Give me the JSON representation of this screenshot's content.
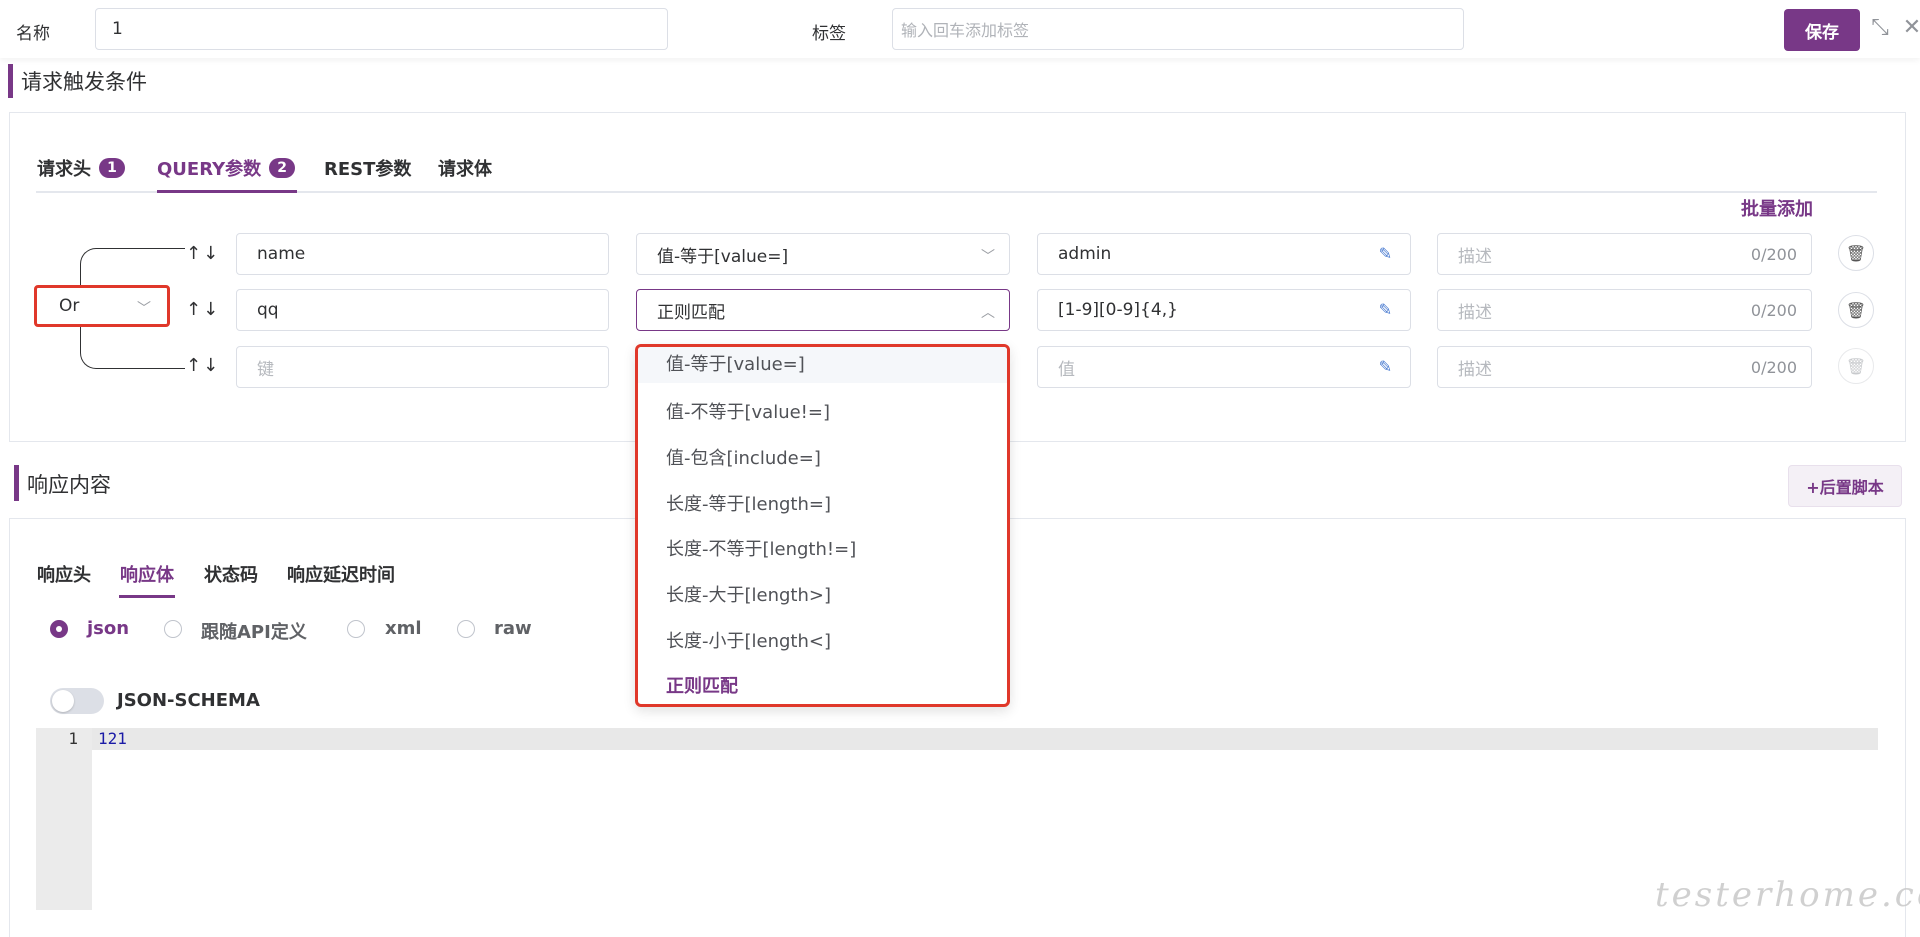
{
  "header": {
    "name_label": "名称",
    "name_value": "1",
    "tag_label": "标签",
    "tag_placeholder": "输入回车添加标签",
    "save_label": "保存"
  },
  "request_section": {
    "title": "请求触发条件",
    "tabs": [
      {
        "label": "请求头",
        "badge": "1"
      },
      {
        "label": "QUERY参数",
        "badge": "2",
        "active": true
      },
      {
        "label": "REST参数"
      },
      {
        "label": "请求体"
      }
    ],
    "batch_add": "批量添加",
    "logic_select": "Or",
    "rows": [
      {
        "key": "name",
        "condition": "值-等于[value=]",
        "value": "admin",
        "desc_placeholder": "描述",
        "desc_count": "0/200"
      },
      {
        "key": "qq",
        "condition": "正则匹配",
        "value": "[1-9][0-9]{4,}",
        "desc_placeholder": "描述",
        "desc_count": "0/200"
      },
      {
        "key_placeholder": "键",
        "value_placeholder": "值",
        "desc_placeholder": "描述",
        "desc_count": "0/200"
      }
    ],
    "arrows": "↑↓",
    "dropdown_options": [
      "值-等于[value=]",
      "值-不等于[value!=]",
      "值-包含[include=]",
      "长度-等于[length=]",
      "长度-不等于[length!=]",
      "长度-大于[length>]",
      "长度-小于[length<]",
      "正则匹配"
    ],
    "dropdown_selected": "正则匹配"
  },
  "response_section": {
    "title": "响应内容",
    "post_script_button": "+后置脚本",
    "tabs": [
      {
        "label": "响应头"
      },
      {
        "label": "响应体",
        "active": true
      },
      {
        "label": "状态码"
      },
      {
        "label": "响应延迟时间"
      }
    ],
    "formats": [
      {
        "label": "json",
        "checked": true
      },
      {
        "label": "跟随API定义"
      },
      {
        "label": "xml"
      },
      {
        "label": "raw"
      }
    ],
    "json_schema_label": "JSON-SCHEMA",
    "json_schema_enabled": false,
    "editor": {
      "line_number": "1",
      "code": "121"
    }
  },
  "watermark": "testerhome.com",
  "colors": {
    "accent": "#783887",
    "highlight_border": "#e0382a"
  }
}
